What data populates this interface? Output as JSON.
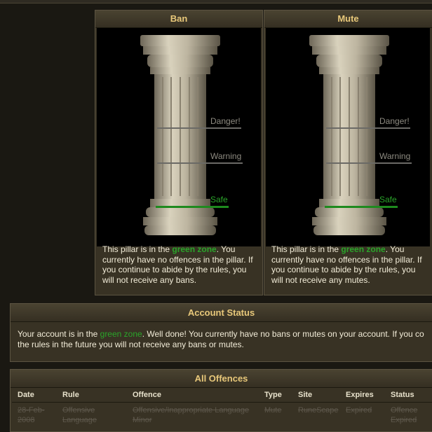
{
  "ban": {
    "title": "Ban",
    "levels": {
      "danger": "Danger!",
      "warning": "Warning",
      "safe": "Safe"
    },
    "text_before": "This pillar is in the ",
    "text_zone": "green zone",
    "text_after": ". You currently have no offences in the pillar. If you continue to abide by the rules, you will not receive any bans."
  },
  "mute": {
    "title": "Mute",
    "levels": {
      "danger": "Danger!",
      "warning": "Warning",
      "safe": "Safe"
    },
    "text_before": "This pillar is in the ",
    "text_zone": "green zone",
    "text_after": ". You currently have no offences in the pillar. If you continue to abide by the rules, you will not receive any mutes."
  },
  "account": {
    "title": "Account Status",
    "line1_before": "Your account is in the ",
    "line1_zone": "green zone",
    "line1_after": ". Well done! You currently have no bans or mutes on your account. If you co",
    "line2": "the rules in the future you will not receive any bans or mutes."
  },
  "offences": {
    "title": "All Offences",
    "columns": [
      "Date",
      "Rule",
      "Offence",
      "Type",
      "Site",
      "Expires",
      "Status"
    ],
    "rows": [
      [
        "28-Feb-2008",
        "Offensive Language",
        "Offensive/Inappropriate Language Minor",
        "Mute",
        "RuneScape",
        "Expired",
        "Offence Expired"
      ]
    ]
  },
  "colors": {
    "accent": "#e8c87a",
    "safe": "#2aa52a",
    "panel": "#383224"
  }
}
